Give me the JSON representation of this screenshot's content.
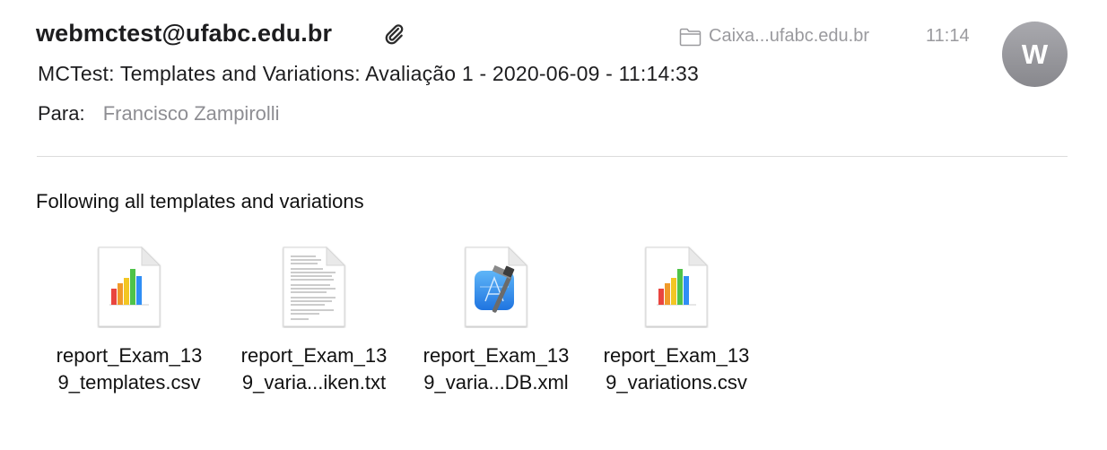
{
  "header": {
    "sender": "webmctest@ufabc.edu.br",
    "mailbox": "Caixa...ufabc.edu.br",
    "time": "11:14",
    "avatar_initial": "W",
    "subject": "MCTest: Templates and Variations: Avaliação 1 - 2020-06-09 - 11:14:33",
    "to_label": "Para:",
    "to_name": "Francisco Zampirolli"
  },
  "message": {
    "body": "Following all templates and variations"
  },
  "attachments": [
    {
      "line1": "report_Exam_13",
      "line2": "9_templates.csv",
      "icon": "numbers-chart-icon"
    },
    {
      "line1": "report_Exam_13",
      "line2": "9_varia...iken.txt",
      "icon": "text-document-icon"
    },
    {
      "line1": "report_Exam_13",
      "line2": "9_varia...DB.xml",
      "icon": "xcode-document-icon"
    },
    {
      "line1": "report_Exam_13",
      "line2": "9_variations.csv",
      "icon": "numbers-chart-icon"
    }
  ],
  "colors": {
    "secondary_text": "#8e8e93",
    "avatar": "#9b9ba0",
    "divider": "#dcdcdc"
  }
}
